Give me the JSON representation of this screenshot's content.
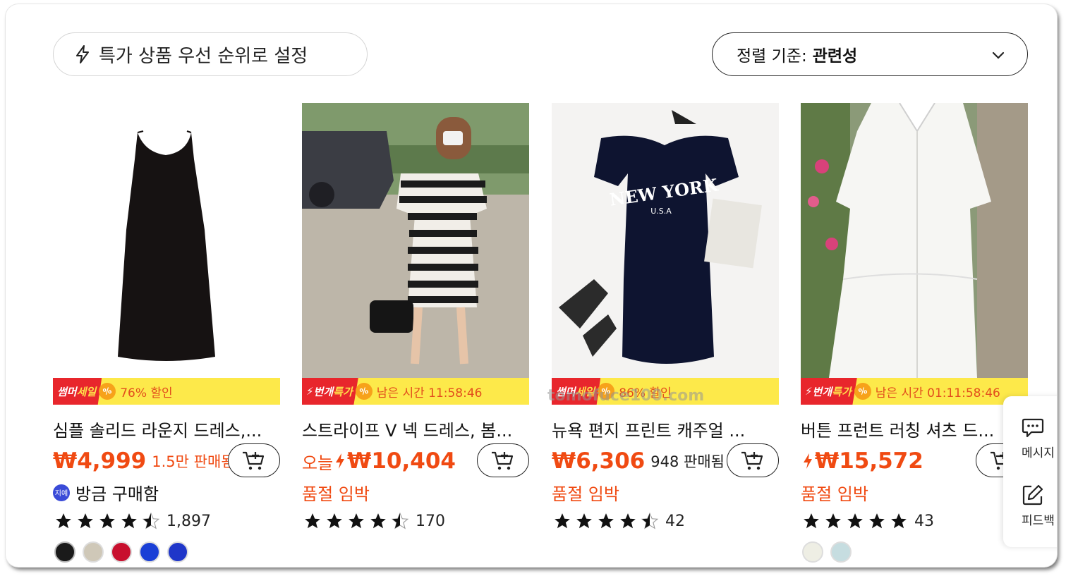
{
  "toolbar": {
    "priority_label": "특가 상품 우선 순위로 설정",
    "sort_prefix": "정렬 기준:",
    "sort_value": "관련성"
  },
  "products": [
    {
      "promo_tag_a": "썸머",
      "promo_tag_b": "세일",
      "promo_pct": "%",
      "promo_text": "76% 할인",
      "title": "심플 솔리드 라운지 드레스,...",
      "price": "₩4,999",
      "sold": "1.5만 판매됨",
      "sub": "방금 구매함",
      "sub_badge": "지예",
      "rating_count": "1,897",
      "rating": 4.5,
      "swatches": [
        "#1a1a1a",
        "#cfc8b8",
        "#c8102e",
        "#1a3fd6",
        "#1f36c9"
      ]
    },
    {
      "promo_tag_a": "번개",
      "promo_tag_b": "특가",
      "promo_pct": "%",
      "promo_text": "남은 시간 11:58:46",
      "title": "스트라이프 V 넥 드레스, 봄...",
      "price_prefix": "오늘",
      "price": "₩10,404",
      "sub": "품절 임박",
      "rating_count": "170",
      "rating": 4.5
    },
    {
      "promo_tag_a": "썸머",
      "promo_tag_b": "세일",
      "promo_pct": "%",
      "promo_text": "86% 할인",
      "title": "뉴욕 편지 프린트 캐주얼 ...",
      "price": "₩6,306",
      "sold": "948 판매됨",
      "sub": "품절 임박",
      "rating_count": "42",
      "rating": 4.5,
      "print_line1": "NEW YORK",
      "print_line2": "U.S.A"
    },
    {
      "promo_tag_a": "번개",
      "promo_tag_b": "특가",
      "promo_pct": "%",
      "promo_text": "남은 시간 01:11:58:46",
      "title": "버튼 프런트 러칭 셔츠 드...",
      "price": "₩15,572",
      "sub": "품절 임박",
      "rating_count": "43",
      "rating": 5,
      "swatches": [
        "#eeeee4",
        "#c6dde0"
      ]
    }
  ],
  "side_panel": {
    "message_label": "메시지",
    "feedback_label": "피드백"
  },
  "watermark": "tomofuce100.com",
  "colors": {
    "accent_orange": "#f04a12",
    "promo_yellow": "#fde94a",
    "promo_red": "#e8262c"
  }
}
